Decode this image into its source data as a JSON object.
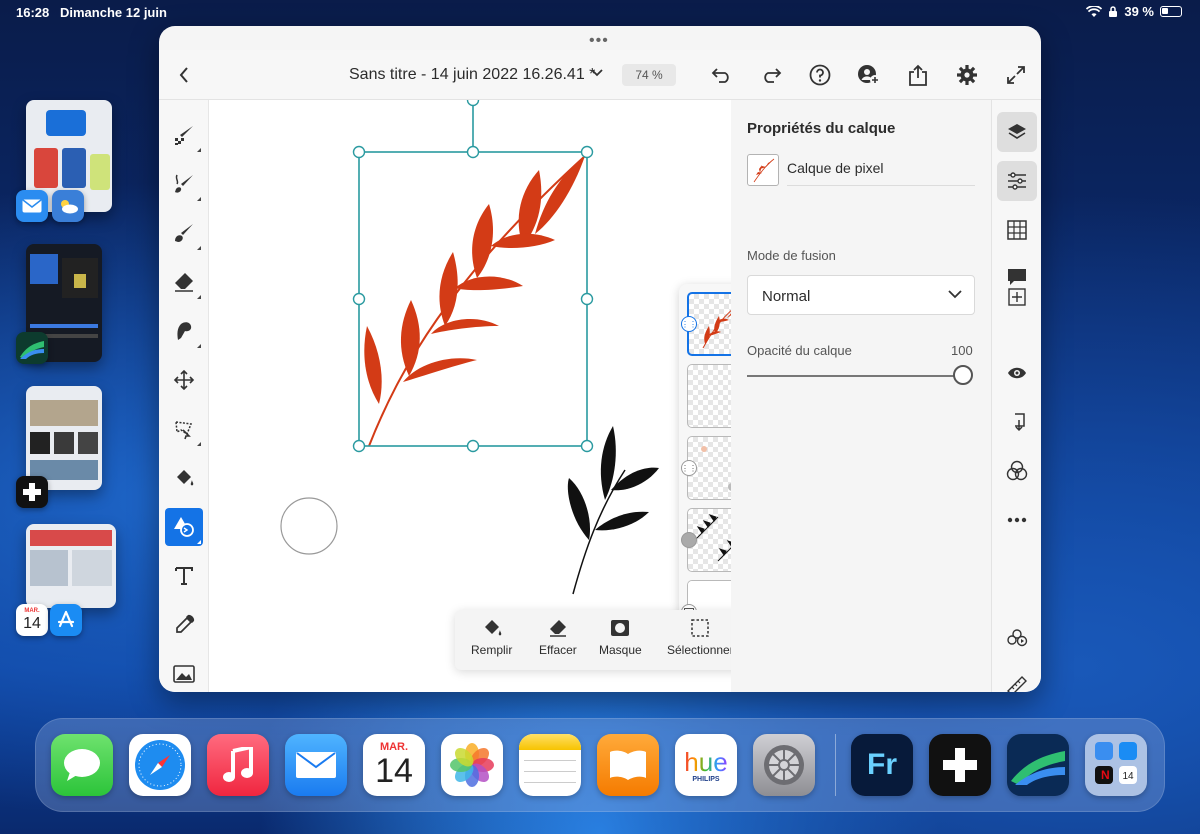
{
  "status_bar": {
    "time": "16:28",
    "date": "Dimanche 12 juin",
    "battery": "39 %"
  },
  "stage": {
    "calendar_month": "MAR.",
    "calendar_day": "14"
  },
  "document": {
    "title": "Sans titre - 14 juin 2022 16.26.41 *",
    "zoom": "74 %"
  },
  "context_bar": {
    "fill": "Remplir",
    "erase": "Effacer",
    "mask": "Masque",
    "select": "Sélectionner"
  },
  "properties": {
    "title": "Propriétés du calque",
    "layer_name": "Calque de pixel",
    "blend_label": "Mode de fusion",
    "blend_value": "Normal",
    "opacity_label": "Opacité du calque",
    "opacity_value": "100"
  },
  "dock": {
    "calendar_month": "MAR.",
    "calendar_day": "14",
    "hue_label": "hue",
    "hue_brand": "PHILIPS",
    "fresco_label": "Fr",
    "folder_day": "14"
  },
  "colors": {
    "accent": "#1473e6",
    "leaf": "#d33b16",
    "selection": "#2a9aa0"
  }
}
